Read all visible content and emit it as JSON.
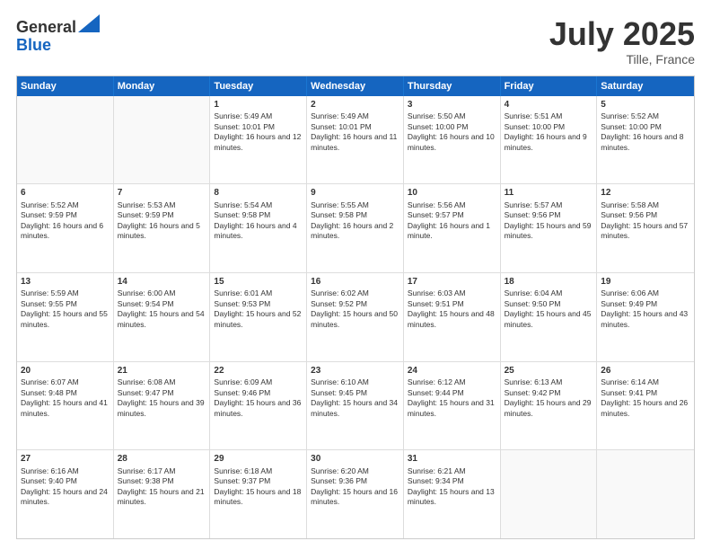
{
  "header": {
    "logo_general": "General",
    "logo_blue": "Blue",
    "month_title": "July 2025",
    "location": "Tille, France"
  },
  "weekdays": [
    "Sunday",
    "Monday",
    "Tuesday",
    "Wednesday",
    "Thursday",
    "Friday",
    "Saturday"
  ],
  "rows": [
    [
      {
        "day": "",
        "info": "",
        "empty": true
      },
      {
        "day": "",
        "info": "",
        "empty": true
      },
      {
        "day": "1",
        "info": "Sunrise: 5:49 AM\nSunset: 10:01 PM\nDaylight: 16 hours and 12 minutes."
      },
      {
        "day": "2",
        "info": "Sunrise: 5:49 AM\nSunset: 10:01 PM\nDaylight: 16 hours and 11 minutes."
      },
      {
        "day": "3",
        "info": "Sunrise: 5:50 AM\nSunset: 10:00 PM\nDaylight: 16 hours and 10 minutes."
      },
      {
        "day": "4",
        "info": "Sunrise: 5:51 AM\nSunset: 10:00 PM\nDaylight: 16 hours and 9 minutes."
      },
      {
        "day": "5",
        "info": "Sunrise: 5:52 AM\nSunset: 10:00 PM\nDaylight: 16 hours and 8 minutes."
      }
    ],
    [
      {
        "day": "6",
        "info": "Sunrise: 5:52 AM\nSunset: 9:59 PM\nDaylight: 16 hours and 6 minutes."
      },
      {
        "day": "7",
        "info": "Sunrise: 5:53 AM\nSunset: 9:59 PM\nDaylight: 16 hours and 5 minutes."
      },
      {
        "day": "8",
        "info": "Sunrise: 5:54 AM\nSunset: 9:58 PM\nDaylight: 16 hours and 4 minutes."
      },
      {
        "day": "9",
        "info": "Sunrise: 5:55 AM\nSunset: 9:58 PM\nDaylight: 16 hours and 2 minutes."
      },
      {
        "day": "10",
        "info": "Sunrise: 5:56 AM\nSunset: 9:57 PM\nDaylight: 16 hours and 1 minute."
      },
      {
        "day": "11",
        "info": "Sunrise: 5:57 AM\nSunset: 9:56 PM\nDaylight: 15 hours and 59 minutes."
      },
      {
        "day": "12",
        "info": "Sunrise: 5:58 AM\nSunset: 9:56 PM\nDaylight: 15 hours and 57 minutes."
      }
    ],
    [
      {
        "day": "13",
        "info": "Sunrise: 5:59 AM\nSunset: 9:55 PM\nDaylight: 15 hours and 55 minutes."
      },
      {
        "day": "14",
        "info": "Sunrise: 6:00 AM\nSunset: 9:54 PM\nDaylight: 15 hours and 54 minutes."
      },
      {
        "day": "15",
        "info": "Sunrise: 6:01 AM\nSunset: 9:53 PM\nDaylight: 15 hours and 52 minutes."
      },
      {
        "day": "16",
        "info": "Sunrise: 6:02 AM\nSunset: 9:52 PM\nDaylight: 15 hours and 50 minutes."
      },
      {
        "day": "17",
        "info": "Sunrise: 6:03 AM\nSunset: 9:51 PM\nDaylight: 15 hours and 48 minutes."
      },
      {
        "day": "18",
        "info": "Sunrise: 6:04 AM\nSunset: 9:50 PM\nDaylight: 15 hours and 45 minutes."
      },
      {
        "day": "19",
        "info": "Sunrise: 6:06 AM\nSunset: 9:49 PM\nDaylight: 15 hours and 43 minutes."
      }
    ],
    [
      {
        "day": "20",
        "info": "Sunrise: 6:07 AM\nSunset: 9:48 PM\nDaylight: 15 hours and 41 minutes."
      },
      {
        "day": "21",
        "info": "Sunrise: 6:08 AM\nSunset: 9:47 PM\nDaylight: 15 hours and 39 minutes."
      },
      {
        "day": "22",
        "info": "Sunrise: 6:09 AM\nSunset: 9:46 PM\nDaylight: 15 hours and 36 minutes."
      },
      {
        "day": "23",
        "info": "Sunrise: 6:10 AM\nSunset: 9:45 PM\nDaylight: 15 hours and 34 minutes."
      },
      {
        "day": "24",
        "info": "Sunrise: 6:12 AM\nSunset: 9:44 PM\nDaylight: 15 hours and 31 minutes."
      },
      {
        "day": "25",
        "info": "Sunrise: 6:13 AM\nSunset: 9:42 PM\nDaylight: 15 hours and 29 minutes."
      },
      {
        "day": "26",
        "info": "Sunrise: 6:14 AM\nSunset: 9:41 PM\nDaylight: 15 hours and 26 minutes."
      }
    ],
    [
      {
        "day": "27",
        "info": "Sunrise: 6:16 AM\nSunset: 9:40 PM\nDaylight: 15 hours and 24 minutes."
      },
      {
        "day": "28",
        "info": "Sunrise: 6:17 AM\nSunset: 9:38 PM\nDaylight: 15 hours and 21 minutes."
      },
      {
        "day": "29",
        "info": "Sunrise: 6:18 AM\nSunset: 9:37 PM\nDaylight: 15 hours and 18 minutes."
      },
      {
        "day": "30",
        "info": "Sunrise: 6:20 AM\nSunset: 9:36 PM\nDaylight: 15 hours and 16 minutes."
      },
      {
        "day": "31",
        "info": "Sunrise: 6:21 AM\nSunset: 9:34 PM\nDaylight: 15 hours and 13 minutes."
      },
      {
        "day": "",
        "info": "",
        "empty": true
      },
      {
        "day": "",
        "info": "",
        "empty": true
      }
    ]
  ]
}
